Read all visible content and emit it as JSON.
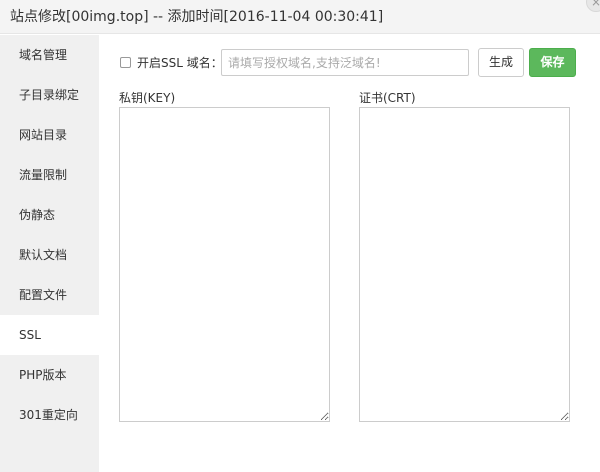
{
  "window": {
    "title": "站点修改[00img.top] -- 添加时间[2016-11-04 00:30:41]",
    "close_glyph": "×"
  },
  "sidebar": {
    "items": [
      {
        "label": "域名管理"
      },
      {
        "label": "子目录绑定"
      },
      {
        "label": "网站目录"
      },
      {
        "label": "流量限制"
      },
      {
        "label": "伪静态"
      },
      {
        "label": "默认文档"
      },
      {
        "label": "配置文件"
      },
      {
        "label": "SSL",
        "active": true
      },
      {
        "label": "PHP版本"
      },
      {
        "label": "301重定向"
      }
    ]
  },
  "ssl": {
    "enable_label": "开启SSL 域名：",
    "enabled": false,
    "domain_value": "",
    "domain_placeholder": "请填写授权域名,支持泛域名!",
    "generate_label": "生成",
    "save_label": "保存",
    "key_label": "私钥(KEY)",
    "key_value": "",
    "crt_label": "证书(CRT)",
    "crt_value": ""
  },
  "colors": {
    "save_button": "#5cb85c",
    "sidebar_bg": "#f0f0f0",
    "titlebar_bg": "#f4f4f4"
  }
}
